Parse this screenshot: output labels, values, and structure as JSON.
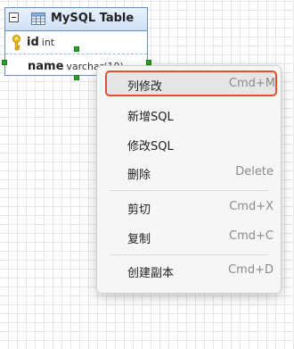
{
  "table": {
    "title": "MySQL Table",
    "rows": [
      {
        "name": "id",
        "type": "int"
      },
      {
        "name": "name",
        "type": "varchar(10)"
      }
    ]
  },
  "context_menu": {
    "items": [
      {
        "label": "列修改",
        "shortcut": "Cmd+M",
        "selected": true
      },
      {
        "label": "新增SQL",
        "shortcut": ""
      },
      {
        "label": "修改SQL",
        "shortcut": ""
      },
      {
        "label": "删除",
        "shortcut": "Delete"
      },
      {
        "label": "剪切",
        "shortcut": "Cmd+X"
      },
      {
        "label": "复制",
        "shortcut": "Cmd+C"
      },
      {
        "label": "创建副本",
        "shortcut": "Cmd+D"
      }
    ]
  },
  "colors": {
    "selection_outline": "#e0522b",
    "handle": "#2aa12a",
    "table_border": "#6c8ebf"
  },
  "icons": [
    "collapse-icon",
    "table-icon",
    "key-icon"
  ]
}
